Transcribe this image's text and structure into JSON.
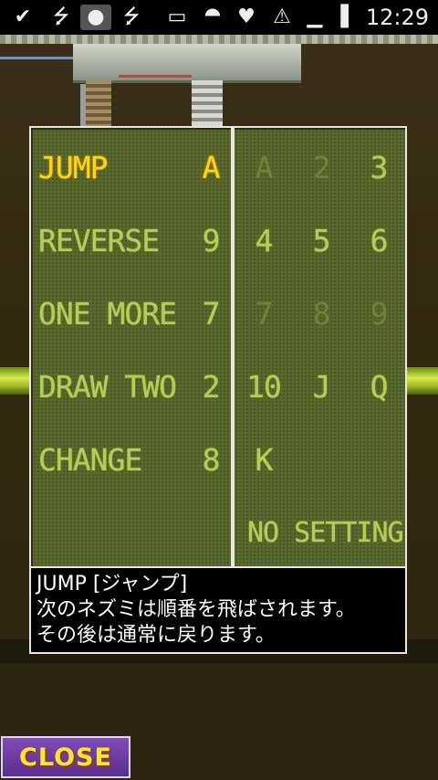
{
  "status_bar": {
    "clock": "12:29",
    "icons": [
      "download-check-icon",
      "usb-icon",
      "android-icon",
      "usb-debug-icon",
      "voicemail-icon",
      "wifi-icon",
      "phone-heart-icon",
      "sd-card-warning-icon",
      "signal-icon",
      "battery-icon"
    ]
  },
  "card_settings": {
    "effects": [
      {
        "name": "JUMP",
        "key": "A",
        "selected": true
      },
      {
        "name": "REVERSE",
        "key": "9",
        "selected": false
      },
      {
        "name": "ONE MORE",
        "key": "7",
        "selected": false
      },
      {
        "name": "DRAW TWO",
        "key": "2",
        "selected": false
      },
      {
        "name": "CHANGE",
        "key": "8",
        "selected": false
      }
    ],
    "cards": [
      {
        "label": "A",
        "enabled": false
      },
      {
        "label": "2",
        "enabled": false
      },
      {
        "label": "3",
        "enabled": true
      },
      {
        "label": "4",
        "enabled": true
      },
      {
        "label": "5",
        "enabled": true
      },
      {
        "label": "6",
        "enabled": true
      },
      {
        "label": "7",
        "enabled": false
      },
      {
        "label": "8",
        "enabled": false
      },
      {
        "label": "9",
        "enabled": false
      },
      {
        "label": "10",
        "enabled": true
      },
      {
        "label": "J",
        "enabled": true
      },
      {
        "label": "Q",
        "enabled": true
      },
      {
        "label": "K",
        "enabled": true
      }
    ],
    "no_setting_label": "NO SETTING"
  },
  "description": {
    "title": "JUMP [ジャンプ]",
    "line1": "次のネズミは順番を飛ばされます。",
    "line2": "その後は通常に戻ります。"
  },
  "close_button": {
    "label": "CLOSE"
  },
  "colors": {
    "lcd_on": "#b4cd54",
    "lcd_off": "#6f8338",
    "lcd_selected": "#ffd21e",
    "close_bg": "#6a3aa0",
    "close_text": "#ffe23a"
  }
}
